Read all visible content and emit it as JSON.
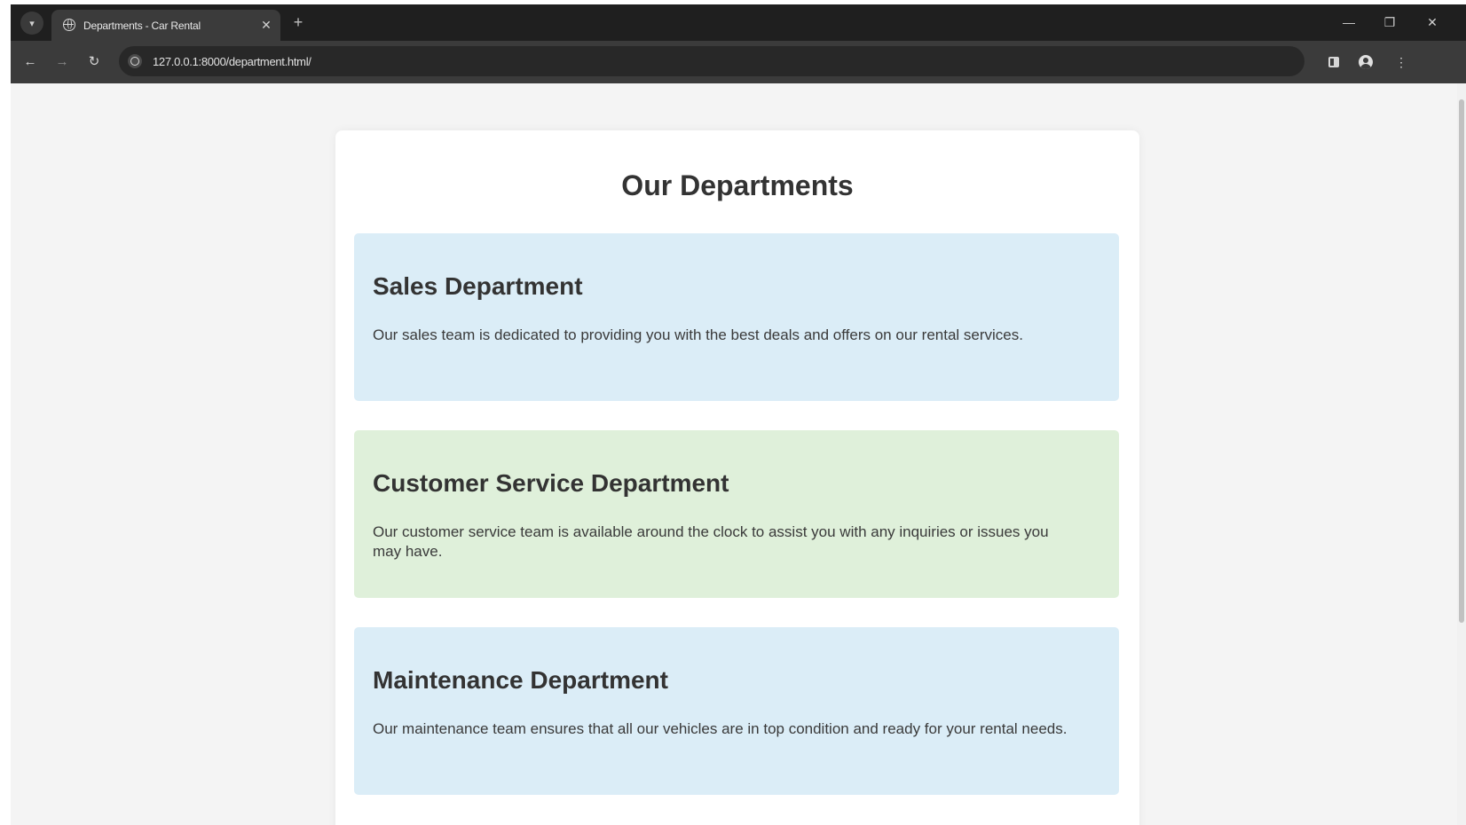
{
  "browser": {
    "tab_title": "Departments - Car Rental",
    "url": "127.0.0.1:8000/department.html/"
  },
  "page": {
    "title": "Our Departments",
    "departments": [
      {
        "name": "Sales Department",
        "description": "Our sales team is dedicated to providing you with the best deals and offers on our rental services.",
        "color": "#dbedf7"
      },
      {
        "name": "Customer Service Department",
        "description": "Our customer service team is available around the clock to assist you with any inquiries or issues you may have.",
        "color": "#dff0da"
      },
      {
        "name": "Maintenance Department",
        "description": "Our maintenance team ensures that all our vehicles are in top condition and ready for your rental needs.",
        "color": "#dbedf7"
      }
    ]
  }
}
